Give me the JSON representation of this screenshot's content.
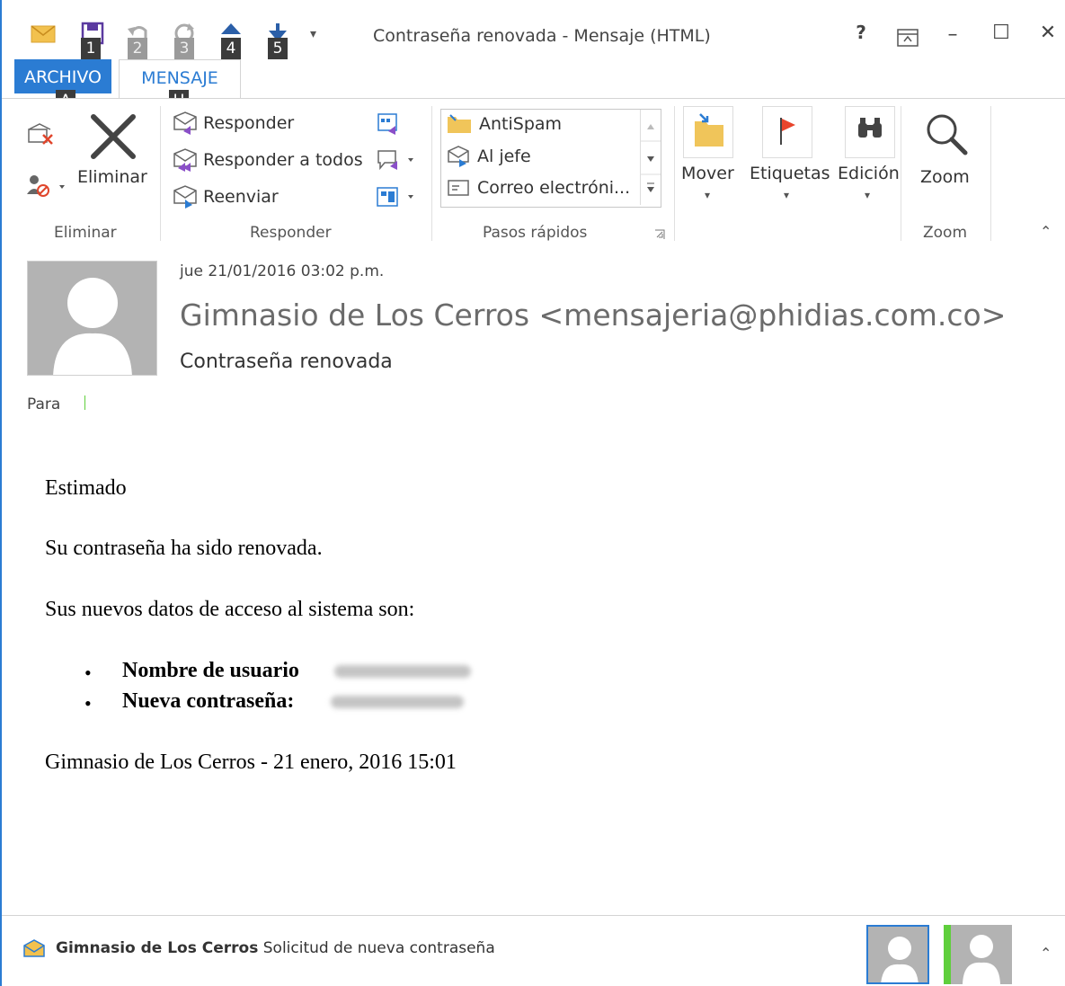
{
  "window": {
    "title": "Contraseña renovada - Mensaje (HTML)",
    "help": "?",
    "restore_icon": "restore-ribbon-icon",
    "minimize": "–",
    "maximize": "☐",
    "close": "✕"
  },
  "qat": {
    "keytips": [
      "1",
      "2",
      "3",
      "4",
      "5"
    ],
    "customize": "▾"
  },
  "tabs": {
    "archivo": "ARCHIVO",
    "archivo_keytip": "A",
    "mensaje": "MENSAJE",
    "mensaje_keytip": "H"
  },
  "ribbon": {
    "eliminar": {
      "delete_label": "Eliminar",
      "group_label": "Eliminar"
    },
    "responder": {
      "reply": "Responder",
      "reply_all": "Responder a todos",
      "forward": "Reenviar",
      "group_label": "Responder"
    },
    "pasos_rapidos": {
      "items": [
        "AntiSpam",
        "Al jefe",
        "Correo electróni..."
      ],
      "group_label": "Pasos rápidos"
    },
    "mover": {
      "label": "Mover"
    },
    "etiquetas": {
      "label": "Etiquetas"
    },
    "edicion": {
      "label": "Edición"
    },
    "zoom": {
      "label": "Zoom",
      "group_label": "Zoom"
    }
  },
  "message": {
    "date": "jue 21/01/2016 03:02 p.m.",
    "from": "Gimnasio de Los Cerros <mensajeria@phidias.com.co>",
    "subject": "Contraseña renovada",
    "to_label": "Para",
    "body": {
      "greeting": "Estimado",
      "line1": "Su contraseña ha sido renovada.",
      "line2": "Sus nuevos datos de acceso al sistema son:",
      "bullets": [
        "Nombre de usuario",
        "Nueva contraseña:"
      ],
      "signature": "Gimnasio de Los Cerros - 21 enero, 2016 15:01"
    }
  },
  "people_bar": {
    "sender": "Gimnasio de Los Cerros",
    "subject": "Solicitud de nueva contraseña"
  },
  "colors": {
    "accent": "#2b7cd3",
    "presence": "#5fcf3c",
    "flag": "#e8452c",
    "folder": "#f0c55a"
  }
}
